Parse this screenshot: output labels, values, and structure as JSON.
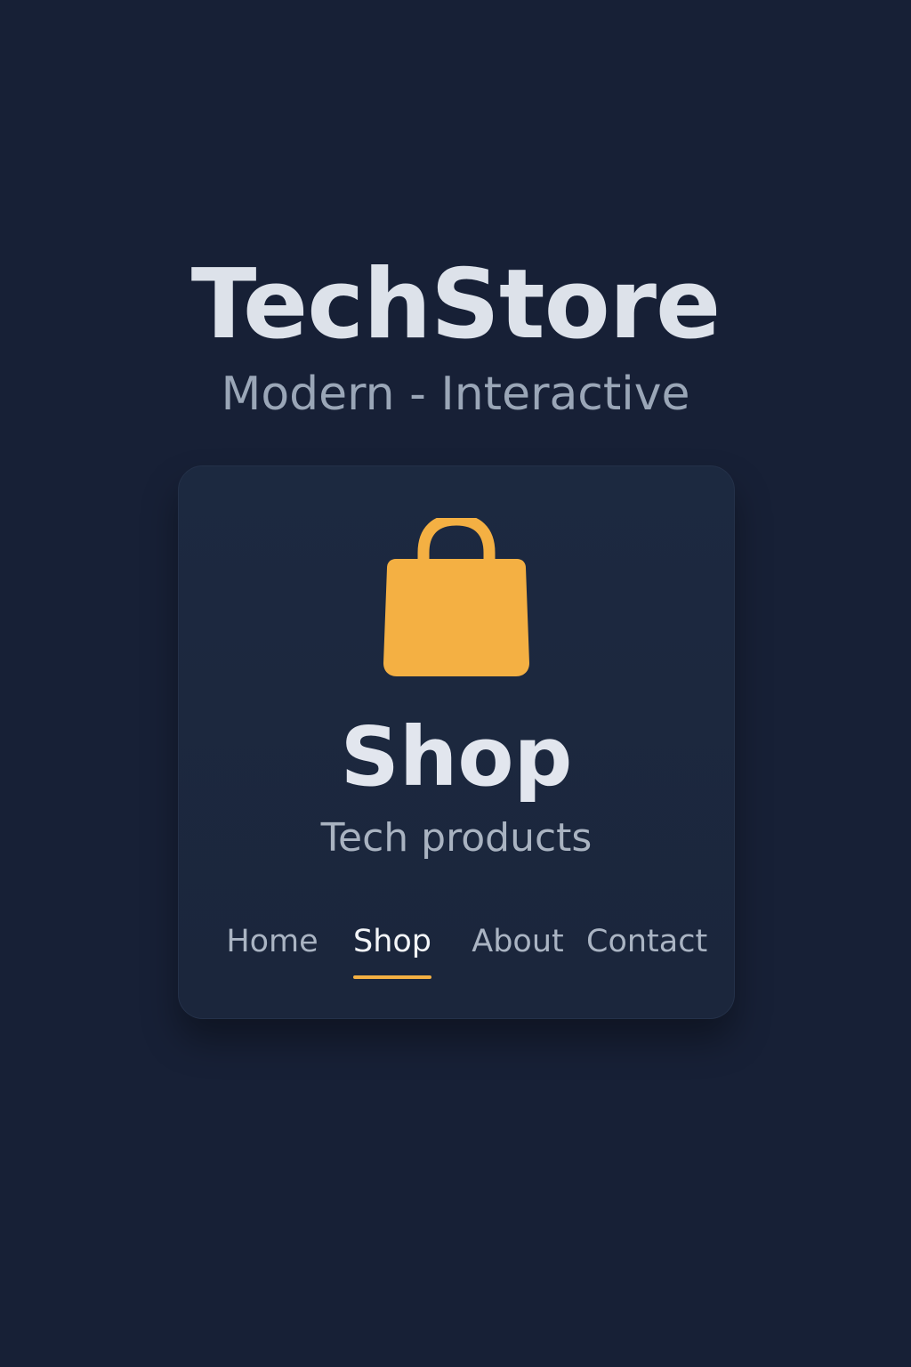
{
  "header": {
    "title": "TechStore",
    "tagline": "Modern - Interactive"
  },
  "card": {
    "icon": "shopping-bag-icon",
    "title": "Shop",
    "subtitle": "Tech products"
  },
  "nav": {
    "items": [
      {
        "label": "Home",
        "active": false
      },
      {
        "label": "Shop",
        "active": true
      },
      {
        "label": "About",
        "active": false
      },
      {
        "label": "Contact",
        "active": false
      }
    ]
  },
  "colors": {
    "background": "#172036",
    "card": "#1c2940",
    "accent": "#f4b043",
    "text_primary": "#dde2ea",
    "text_secondary": "#9aa6b7"
  }
}
